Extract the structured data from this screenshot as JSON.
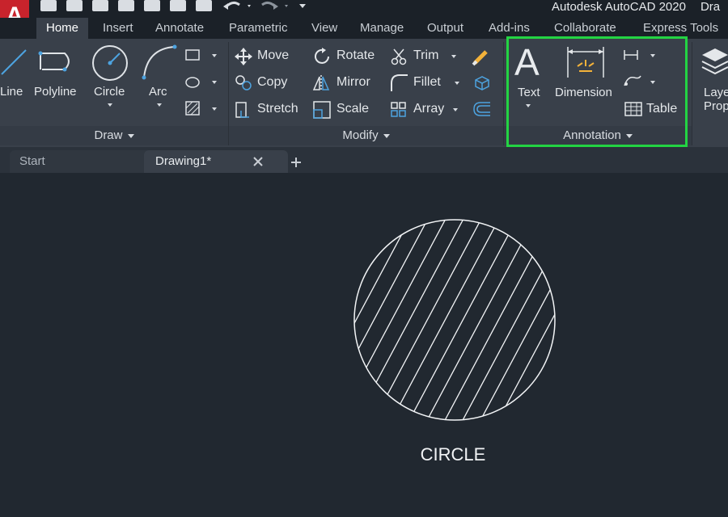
{
  "app": {
    "logo_letter": "A",
    "title": "Autodesk AutoCAD 2020",
    "title_suffix": "Dra"
  },
  "ribbon_tabs": [
    "Home",
    "Insert",
    "Annotate",
    "Parametric",
    "View",
    "Manage",
    "Output",
    "Add-ins",
    "Collaborate",
    "Express Tools"
  ],
  "draw_panel": {
    "title": "Draw",
    "tools": [
      "Line",
      "Polyline",
      "Circle",
      "Arc"
    ]
  },
  "modify_panel": {
    "title": "Modify",
    "tools": [
      "Move",
      "Rotate",
      "Trim",
      "Copy",
      "Mirror",
      "Fillet",
      "Stretch",
      "Scale",
      "Array"
    ]
  },
  "annotation_panel": {
    "title": "Annotation",
    "text": "Text",
    "dimension": "Dimension",
    "table": "Table"
  },
  "layers_panel": {
    "label_top": "Laye",
    "label_bottom": "Proper"
  },
  "doc_tabs": {
    "start": "Start",
    "drawing": "Drawing1*",
    "close_icon": "close-icon",
    "add_icon": "plus-icon"
  },
  "canvas": {
    "shape_label": "CIRCLE"
  },
  "colors": {
    "highlight": "#23d443",
    "logo": "#c8232c",
    "ribbon": "#39404a",
    "canvas": "#212830"
  }
}
